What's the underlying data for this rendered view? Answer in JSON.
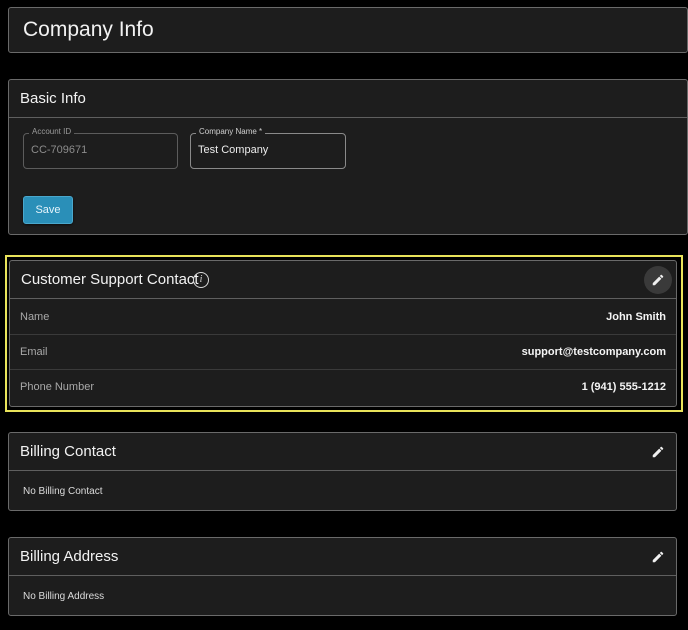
{
  "page": {
    "title": "Company Info"
  },
  "basic_info": {
    "title": "Basic Info",
    "account_id": {
      "label": "Account ID",
      "value": "CC-709671"
    },
    "company_name": {
      "label": "Company Name *",
      "value": "Test Company"
    },
    "save_label": "Save"
  },
  "support_contact": {
    "title": "Customer Support Contact",
    "info_icon": "info-icon",
    "edit_icon": "pencil-icon",
    "rows": [
      {
        "label": "Name",
        "value": "John Smith"
      },
      {
        "label": "Email",
        "value": "support@testcompany.com"
      },
      {
        "label": "Phone Number",
        "value": "1 (941) 555-1212"
      }
    ],
    "highlight_color": "#e9e35a"
  },
  "billing_contact": {
    "title": "Billing Contact",
    "empty_text": "No Billing Contact",
    "edit_icon": "pencil-icon"
  },
  "billing_address": {
    "title": "Billing Address",
    "empty_text": "No Billing Address",
    "edit_icon": "pencil-icon"
  },
  "colors": {
    "background": "#000000",
    "card": "#1d1d1d",
    "accent": "#2a8fb8",
    "highlight": "#e9e35a"
  }
}
